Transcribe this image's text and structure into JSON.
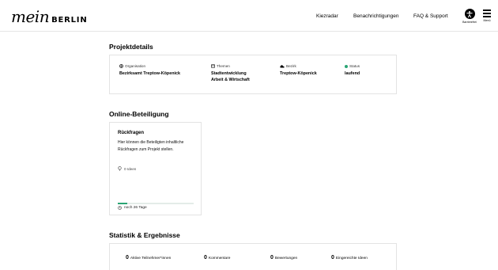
{
  "header": {
    "logo_script": "mein",
    "logo_word": "BERLIN",
    "nav": [
      "Kiezradar",
      "Benachrichtigungen",
      "FAQ & Support"
    ],
    "accessibility_label": "Barrierefrei",
    "menu_label": "Menü"
  },
  "details": {
    "title": "Projektdetails",
    "organisation": {
      "label": "Organisation",
      "value": "Bezirksamt Treptow-Köpenick"
    },
    "themen": {
      "label": "Themen",
      "values": [
        "Stadtentwicklung",
        "Arbeit & Wirtschaft"
      ]
    },
    "bezirk": {
      "label": "Bezirk",
      "value": "Treptow-Köpenick"
    },
    "status": {
      "label": "Status",
      "value": "laufend"
    }
  },
  "participation": {
    "title": "Online-Beteiligung",
    "card": {
      "title": "Rückfragen",
      "description": "Hier können die Beteiligten inhaltliche Rückfragen zum Projekt stellen.",
      "ideas": "0 Ideen",
      "progress": 0.12,
      "remaining": "noch 26 Tage"
    }
  },
  "stats": {
    "title": "Statistik & Ergebnisse",
    "items": [
      {
        "num": "0",
        "label": "Aktive Teilnehmer*innen"
      },
      {
        "num": "0",
        "label": "Kommentare"
      },
      {
        "num": "0",
        "label": "Bewertungen"
      },
      {
        "num": "0",
        "label": "Eingereichte Ideen"
      }
    ]
  },
  "colors": {
    "accent": "#2aa574",
    "border": "#e3e3e3"
  }
}
